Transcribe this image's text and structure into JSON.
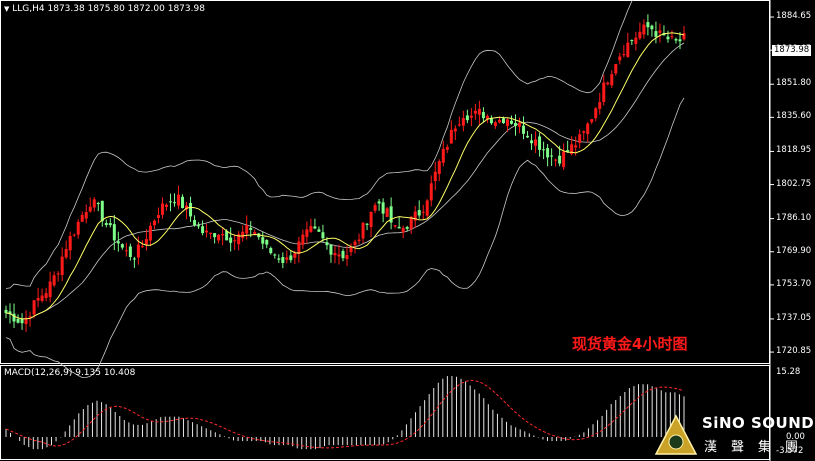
{
  "header": {
    "symbol": "LLG,H4",
    "ohlc": "1873.38 1875.80 1872.00 1873.98"
  },
  "price_axis": {
    "ticks": [
      "1884.65",
      "1868.45",
      "1851.80",
      "1835.60",
      "1818.95",
      "1802.75",
      "1786.10",
      "1769.90",
      "1753.70",
      "1737.05",
      "1720.85"
    ],
    "current": "1873.98"
  },
  "chart_title": "现货黄金4小时图",
  "macd": {
    "label": "MACD(12,26,9) 9.135 10.408",
    "ticks": [
      "15.28",
      "0.00",
      "-3.572"
    ]
  },
  "logo": {
    "name": "SiNO SOUND",
    "cn": "漢聲集團"
  },
  "colors": {
    "up": "#ff1a1a",
    "down": "#7dff8a",
    "ma": "#ffff66",
    "band": "#c8c8c8",
    "signal": "#ff2a2a"
  },
  "chart_data": {
    "type": "candlestick",
    "ylim": [
      1716,
      1892
    ],
    "close_path": [
      1740,
      1738,
      1735,
      1742,
      1748,
      1752,
      1760,
      1772,
      1780,
      1788,
      1795,
      1790,
      1782,
      1776,
      1770,
      1768,
      1772,
      1782,
      1790,
      1794,
      1797,
      1792,
      1786,
      1780,
      1778,
      1780,
      1778,
      1776,
      1779,
      1782,
      1776,
      1770,
      1768,
      1765,
      1770,
      1776,
      1780,
      1778,
      1772,
      1770,
      1768,
      1772,
      1780,
      1790,
      1794,
      1788,
      1780,
      1782,
      1786,
      1790,
      1800,
      1812,
      1822,
      1832,
      1838,
      1836,
      1838,
      1836,
      1834,
      1836,
      1833,
      1830,
      1826,
      1822,
      1818,
      1815,
      1818,
      1822,
      1826,
      1835,
      1845,
      1855,
      1864,
      1870,
      1874,
      1878,
      1880,
      1876,
      1874,
      1872,
      1874
    ],
    "macd_hist": [
      2,
      0,
      -2,
      -3,
      -3,
      -2,
      0,
      3,
      6,
      8,
      9,
      8,
      6,
      4,
      3,
      3,
      4,
      5,
      5,
      5,
      4,
      3,
      2,
      1,
      0,
      -1,
      -1,
      -1,
      -1,
      -2,
      -2,
      -2,
      -3,
      -3,
      -3,
      -2,
      -2,
      -2,
      -2,
      -2,
      -2,
      -2,
      -1,
      1,
      4,
      7,
      10,
      13,
      15,
      15,
      14,
      12,
      10,
      7,
      5,
      3,
      2,
      1,
      0,
      -1,
      -1,
      -1,
      0,
      1,
      3,
      5,
      8,
      10,
      12,
      13,
      13,
      12,
      11,
      11,
      10
    ]
  }
}
